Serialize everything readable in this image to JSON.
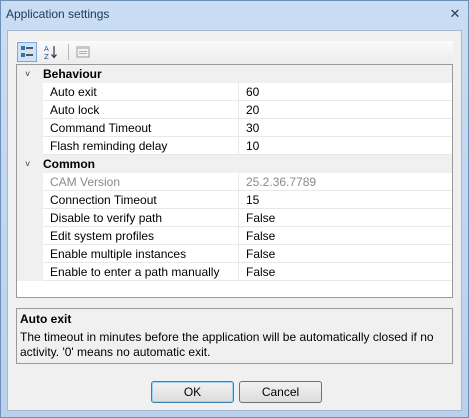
{
  "window": {
    "title": "Application settings",
    "close_glyph": "✕"
  },
  "toolbar": {
    "categorized_icon": "categorized-icon",
    "alphabetical_icon": "sort-alphabetical-icon",
    "property_pages_icon": "property-pages-icon"
  },
  "grid": {
    "categories": [
      {
        "label": "Behaviour",
        "rows": [
          {
            "name": "Auto exit",
            "value": "60"
          },
          {
            "name": "Auto lock",
            "value": "20"
          },
          {
            "name": "Command Timeout",
            "value": "30"
          },
          {
            "name": "Flash reminding delay",
            "value": "10"
          }
        ]
      },
      {
        "label": "Common",
        "rows": [
          {
            "name": "CAM Version",
            "value": "25.2.36.7789"
          },
          {
            "name": "Connection Timeout",
            "value": "15"
          },
          {
            "name": "Disable to verify path",
            "value": "False"
          },
          {
            "name": "Edit system profiles",
            "value": "False"
          },
          {
            "name": "Enable multiple instances",
            "value": "False"
          },
          {
            "name": "Enable to enter a path manually",
            "value": "False"
          }
        ]
      }
    ]
  },
  "description": {
    "title": "Auto exit",
    "text": "The timeout in minutes before  the application will be automatically closed if no activity. '0' means no automatic exit."
  },
  "buttons": {
    "ok": "OK",
    "cancel": "Cancel"
  }
}
